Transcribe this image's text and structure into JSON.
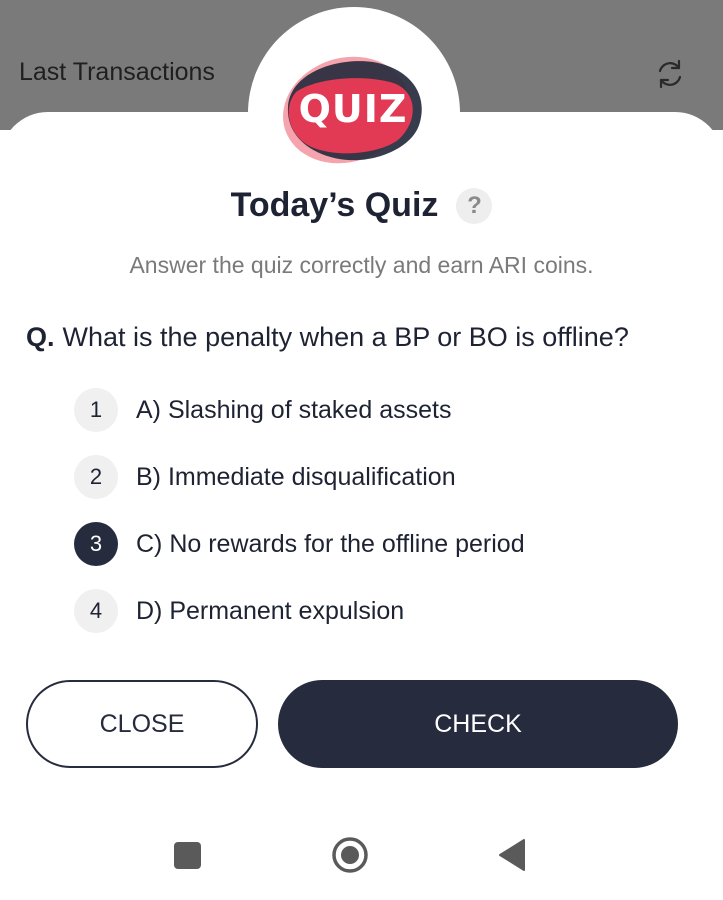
{
  "background": {
    "title": "Last Transactions",
    "refresh_icon": "refresh-icon"
  },
  "quiz": {
    "logo_text": "QUIZ",
    "title": "Today’s Quiz",
    "help_label": "?",
    "subtitle": "Answer the quiz correctly and earn ARI coins.",
    "question_prefix": "Q.",
    "question": "What is the penalty when a BP or BO is offline?",
    "options": [
      {
        "number": "1",
        "label": "A) Slashing of staked assets"
      },
      {
        "number": "2",
        "label": "B) Immediate disqualification"
      },
      {
        "number": "3",
        "label": "C) No rewards for the offline period",
        "selected": true
      },
      {
        "number": "4",
        "label": "D) Permanent expulsion"
      }
    ],
    "close_label": "CLOSE",
    "check_label": "CHECK"
  },
  "colors": {
    "accent_dark": "#262b3d",
    "logo_pink": "#f5a3ad",
    "logo_red": "#e23a55"
  },
  "navbar": {
    "icons": [
      "recents-icon",
      "home-icon",
      "back-icon"
    ]
  }
}
